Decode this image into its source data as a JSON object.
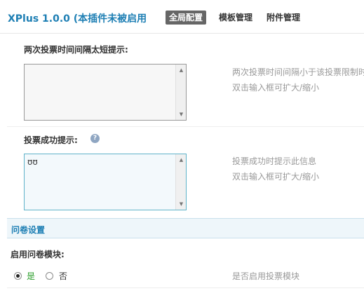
{
  "header": {
    "title": "XPlus 1.0.0 (本插件未被启用",
    "tabs": [
      {
        "label": "全局配置",
        "active": true
      },
      {
        "label": "模板管理",
        "active": false
      },
      {
        "label": "附件管理",
        "active": false
      }
    ]
  },
  "fields": {
    "interval": {
      "label": "两次投票时间间隔太短提示:",
      "value": "",
      "hint_line1": "两次投票时间间隔小于该投票限制时",
      "hint_line2": "双击输入框可扩大/缩小"
    },
    "success": {
      "label": "投票成功提示:",
      "help_icon": "?",
      "value": "ʊʊ",
      "hint_line1": "投票成功时提示此信息",
      "hint_line2": "双击输入框可扩大/缩小"
    }
  },
  "section": {
    "title": "问卷设置"
  },
  "questionnaire": {
    "label": "启用问卷模块:",
    "yes_label": "是",
    "no_label": "否",
    "selected": "yes",
    "hint": "是否启用投票模块"
  },
  "colors": {
    "title_blue": "#1e7fb4",
    "active_tab_bg": "#666666",
    "yes_green": "#2a9d2a",
    "section_bg": "#eef6fa"
  }
}
